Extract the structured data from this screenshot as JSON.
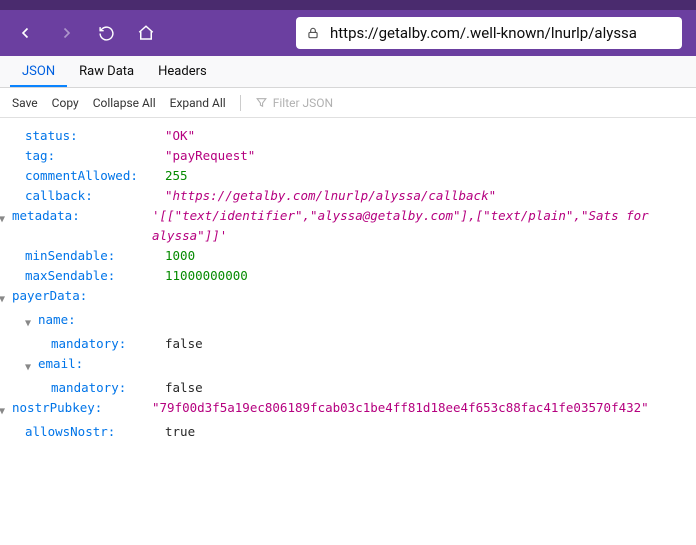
{
  "browser": {
    "url": "https://getalby.com/.well-known/lnurlp/alyssa"
  },
  "tabs": {
    "json": "JSON",
    "raw": "Raw Data",
    "headers": "Headers"
  },
  "actions": {
    "save": "Save",
    "copy": "Copy",
    "collapse": "Collapse All",
    "expand": "Expand All",
    "filterPlaceholder": "Filter JSON"
  },
  "json": {
    "status": {
      "k": "status:",
      "v": "\"OK\""
    },
    "tag": {
      "k": "tag:",
      "v": "\"payRequest\""
    },
    "commentAllowed": {
      "k": "commentAllowed:",
      "v": "255"
    },
    "callback": {
      "k": "callback:",
      "v": "\"https://getalby.com/lnurlp/alyssa/callback\""
    },
    "metadata": {
      "k": "metadata:",
      "v": "'[[\"text/identifier\",\"alyssa@getalby.com\"],[\"text/plain\",\"Sats for alyssa\"]]'"
    },
    "minSendable": {
      "k": "minSendable:",
      "v": "1000"
    },
    "maxSendable": {
      "k": "maxSendable:",
      "v": "11000000000"
    },
    "payerData": {
      "k": "payerData:"
    },
    "name": {
      "k": "name:"
    },
    "nameMandatory": {
      "k": "mandatory:",
      "v": "false"
    },
    "email": {
      "k": "email:"
    },
    "emailMandatory": {
      "k": "mandatory:",
      "v": "false"
    },
    "nostrPubkey": {
      "k": "nostrPubkey:",
      "v": "\"79f00d3f5a19ec806189fcab03c1be4ff81d18ee4f653c88fac41fe03570f432\""
    },
    "allowsNostr": {
      "k": "allowsNostr:",
      "v": "true"
    }
  }
}
